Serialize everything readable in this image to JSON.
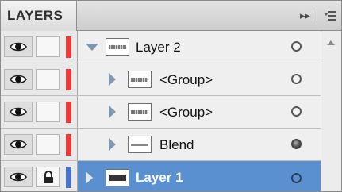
{
  "panel": {
    "tab_label": "LAYERS",
    "header_controls": {
      "expand_icon": "double-chevron-right-icon",
      "menu_icon": "panel-menu-icon"
    }
  },
  "layers": [
    {
      "label": "Layer 2",
      "indent": 0,
      "expanded": true,
      "visible": true,
      "locked": false,
      "color": "#ea3a3a",
      "thumb": "dots",
      "target": "hollow",
      "selected": false
    },
    {
      "label": "<Group>",
      "indent": 1,
      "expanded": false,
      "visible": true,
      "locked": false,
      "color": "#ea3a3a",
      "thumb": "dots",
      "target": "hollow",
      "selected": false
    },
    {
      "label": "<Group>",
      "indent": 1,
      "expanded": false,
      "visible": true,
      "locked": false,
      "color": "#ea3a3a",
      "thumb": "dots",
      "target": "hollow",
      "selected": false
    },
    {
      "label": "Blend",
      "indent": 1,
      "expanded": false,
      "visible": true,
      "locked": false,
      "color": "#ea3a3a",
      "thumb": "blend",
      "target": "filled",
      "selected": false
    },
    {
      "label": "Layer 1",
      "indent": 0,
      "expanded": false,
      "visible": true,
      "locked": true,
      "color": "#4a73c8",
      "thumb": "dark",
      "target": "hollow",
      "selected": true
    }
  ],
  "colors": {
    "selection": "#5a8fd0",
    "accent_red": "#ea3a3a",
    "accent_blue": "#4a73c8"
  }
}
